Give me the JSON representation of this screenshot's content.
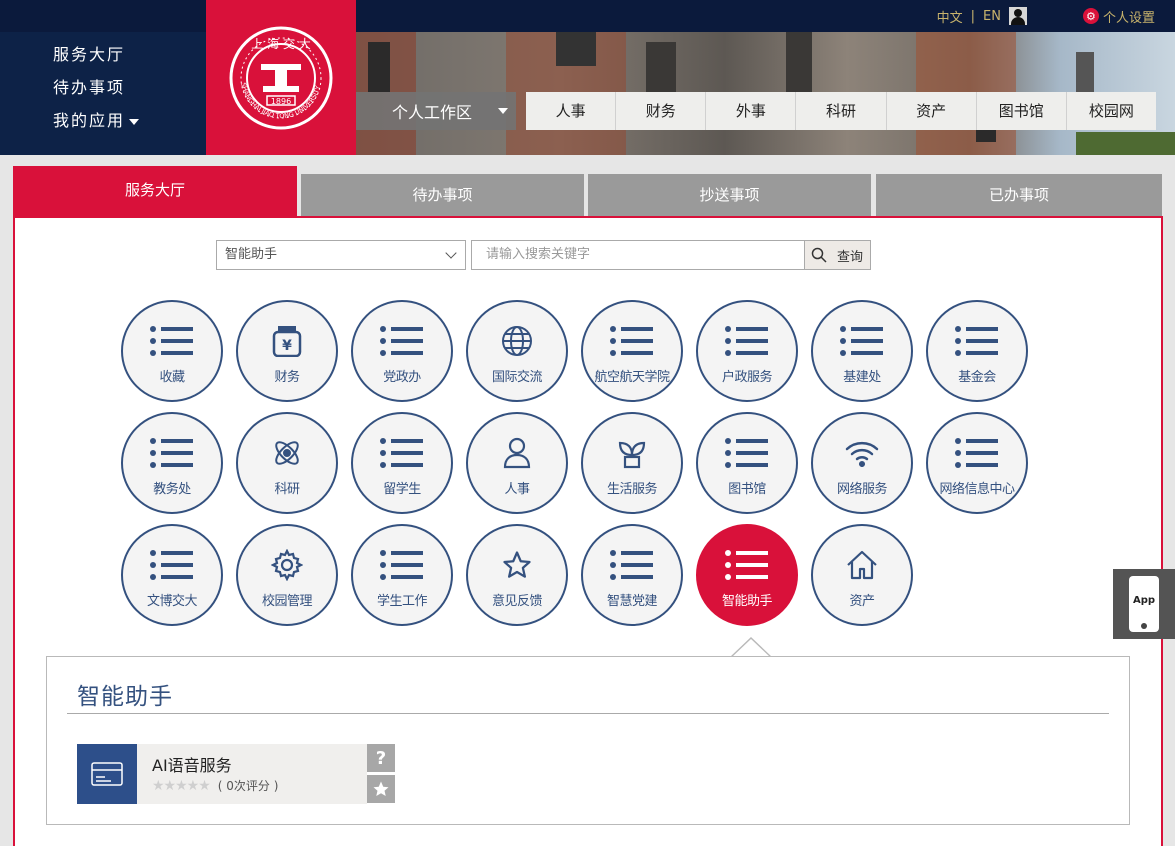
{
  "header": {
    "lang_zh": "中文",
    "lang_sep": "|",
    "lang_en": "EN",
    "settings_label": "个人设置",
    "left_nav": [
      "服务大厅",
      "待办事项",
      "我的应用"
    ],
    "workspace_label": "个人工作区",
    "top_menu": [
      "人事",
      "财务",
      "外事",
      "科研",
      "资产",
      "图书馆",
      "校园网"
    ],
    "logo_year": "1896",
    "logo_text": "SHANGHAI JIAO TONG UNIVERSITY"
  },
  "tabs": [
    "服务大厅",
    "待办事项",
    "抄送事项",
    "已办事项"
  ],
  "search": {
    "category_value": "智能助手",
    "placeholder": "请输入搜索关键字",
    "button_label": "查询"
  },
  "services": [
    {
      "label": "收藏",
      "icon": "list-icon"
    },
    {
      "label": "财务",
      "icon": "yen-jar-icon"
    },
    {
      "label": "党政办",
      "icon": "list-icon"
    },
    {
      "label": "国际交流",
      "icon": "globe-icon"
    },
    {
      "label": "航空航天学院",
      "icon": "list-icon"
    },
    {
      "label": "户政服务",
      "icon": "list-icon"
    },
    {
      "label": "基建处",
      "icon": "list-icon"
    },
    {
      "label": "基金会",
      "icon": "list-icon"
    },
    {
      "label": "教务处",
      "icon": "list-icon"
    },
    {
      "label": "科研",
      "icon": "atom-icon"
    },
    {
      "label": "留学生",
      "icon": "list-icon"
    },
    {
      "label": "人事",
      "icon": "person-icon"
    },
    {
      "label": "生活服务",
      "icon": "plant-icon"
    },
    {
      "label": "图书馆",
      "icon": "list-icon"
    },
    {
      "label": "网络服务",
      "icon": "wifi-icon"
    },
    {
      "label": "网络信息中心",
      "icon": "list-icon"
    },
    {
      "label": "文博交大",
      "icon": "list-icon"
    },
    {
      "label": "校园管理",
      "icon": "gear-icon"
    },
    {
      "label": "学生工作",
      "icon": "list-icon"
    },
    {
      "label": "意见反馈",
      "icon": "star-icon"
    },
    {
      "label": "智慧党建",
      "icon": "list-icon"
    },
    {
      "label": "智能助手",
      "icon": "list-icon",
      "active": true
    },
    {
      "label": "资产",
      "icon": "home-icon"
    }
  ],
  "detail": {
    "title": "智能助手",
    "items": [
      {
        "name": "AI语音服务",
        "rating_stars": 0,
        "rating_text": "( 0次评分 )",
        "help": "?"
      }
    ]
  },
  "app_float": {
    "label": "App"
  },
  "colors": {
    "brand_red": "#d9113a",
    "navy": "#0d2247",
    "circle_border": "#34517f",
    "card_blue": "#2d4f8a"
  }
}
